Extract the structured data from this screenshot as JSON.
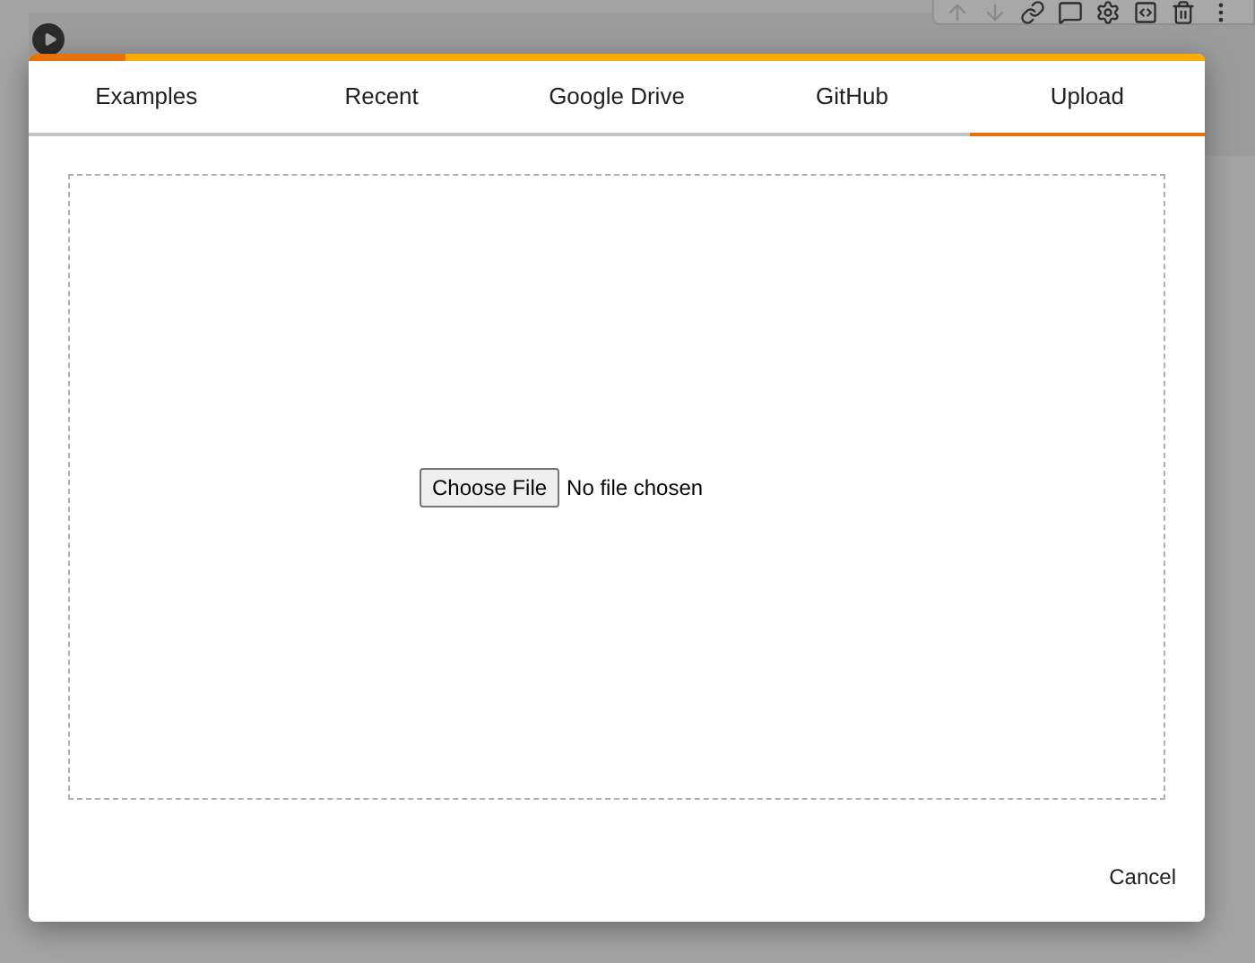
{
  "tabs": [
    {
      "label": "Examples",
      "selected": false
    },
    {
      "label": "Recent",
      "selected": false
    },
    {
      "label": "Google Drive",
      "selected": false
    },
    {
      "label": "GitHub",
      "selected": false
    },
    {
      "label": "Upload",
      "selected": true
    }
  ],
  "upload": {
    "button": "Choose File",
    "status": "No file chosen"
  },
  "buttons": [
    "Cancel"
  ]
}
